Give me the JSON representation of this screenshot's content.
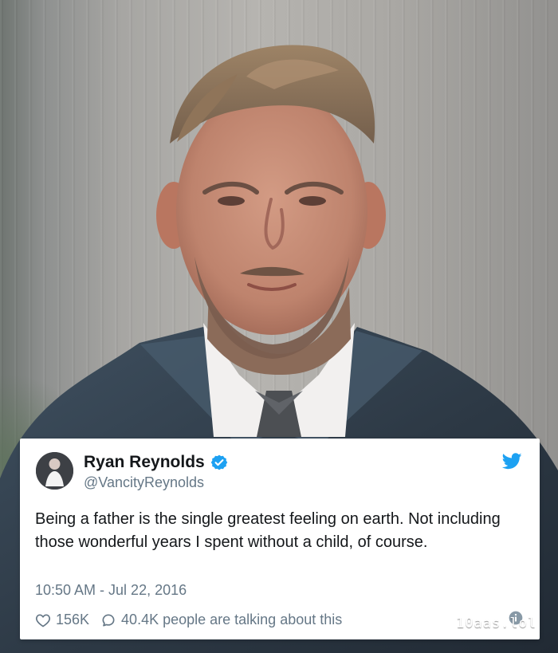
{
  "tweet": {
    "display_name": "Ryan Reynolds",
    "handle": "@VancityReynolds",
    "text": "Being a father is the single greatest feeling on earth. Not including those wonderful years I spent without a child, of course.",
    "timestamp": "10:50 AM - Jul 22, 2016",
    "likes": "156K",
    "replies": "40.4K people are talking about this"
  },
  "watermark": "10aas.lol",
  "colors": {
    "twitter_blue": "#1da1f2",
    "text_dark": "#14171a",
    "text_muted": "#657786"
  },
  "icons": {
    "verified": "verified-badge-icon",
    "twitter": "twitter-bird-icon",
    "like": "heart-icon",
    "reply": "speech-bubble-icon",
    "info": "info-icon"
  }
}
